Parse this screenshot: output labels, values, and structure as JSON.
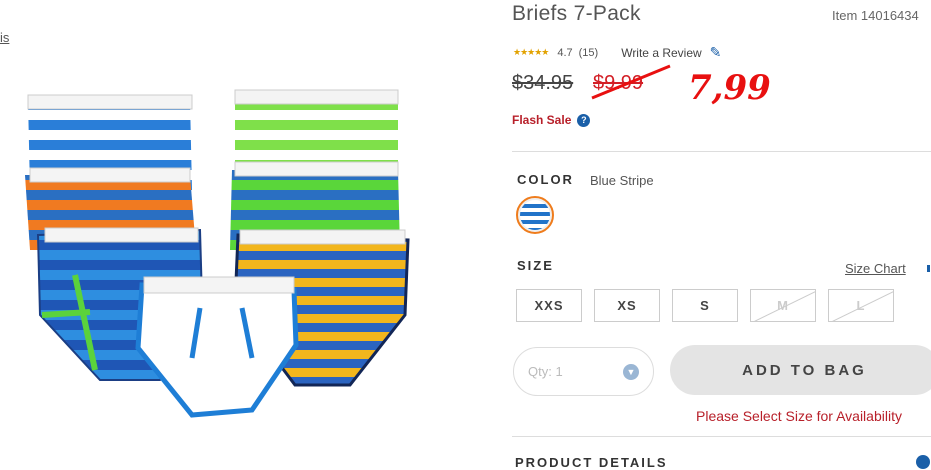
{
  "left_link": "is",
  "product": {
    "title": "Briefs 7-Pack",
    "item_number": "Item 14016434",
    "rating_stars": "★★★★★",
    "rating": "4.7",
    "review_count": "(15)",
    "write_review": "Write a Review",
    "original_price": "$34.95",
    "sale_price": "$9.99",
    "handwritten_price": "7,99",
    "flash_sale": "Flash Sale",
    "flash_help": "?"
  },
  "color": {
    "label": "COLOR",
    "value": "Blue Stripe"
  },
  "size": {
    "label": "SIZE",
    "size_chart": "Size Chart",
    "options": [
      "XXS",
      "XS",
      "S",
      "M",
      "L"
    ]
  },
  "cart": {
    "qty_placeholder": "Qty: 1",
    "add_to_bag": "ADD TO BAG",
    "availability_message": "Please Select Size for Availability"
  },
  "details": {
    "label": "PRODUCT DETAILS"
  },
  "colors": {
    "accent_blue": "#1a5fa8",
    "sale_red": "#d31f26",
    "swatch_border": "#ef7c1c"
  }
}
